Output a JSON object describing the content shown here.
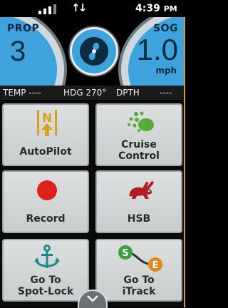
{
  "status_bar": {
    "time": "4:39",
    "ampm": "PM",
    "data_arrows": "↑↓"
  },
  "gauges": {
    "prop": {
      "label": "PROP",
      "value": "3"
    },
    "sog": {
      "label": "SOG",
      "value": "1.0",
      "unit": "mph"
    }
  },
  "info": {
    "temp": "TEMP ----",
    "hdg": "HDG 270°",
    "dpth": "DPTH",
    "dpth_value": "----"
  },
  "tiles": [
    {
      "label_line1": "AutoPilot",
      "label_line2": "",
      "icon": "autopilot-icon"
    },
    {
      "label_line1": "Cruise",
      "label_line2": "Control",
      "icon": "cruise-control-icon"
    },
    {
      "label_line1": "Record",
      "label_line2": "",
      "icon": "record-icon"
    },
    {
      "label_line1": "HSB",
      "label_line2": "",
      "icon": "hsb-rabbit-icon"
    },
    {
      "label_line1": "Go To",
      "label_line2": "Spot-Lock",
      "icon": "anchor-icon"
    },
    {
      "label_line1": "Go To",
      "label_line2": "iTrack",
      "icon": "itrack-icon"
    }
  ],
  "itrack_icon_letters": {
    "start": "S",
    "end": "E"
  },
  "autopilot_letter": "N",
  "colors": {
    "gauge_blue": "#3ea2dc",
    "record_red": "#e0201b",
    "cruise_green": "#5aaa3a",
    "hsb_red": "#b01d1d",
    "anchor_teal": "#1c8a8c",
    "autopilot_gold": "#d9a21e",
    "itrack_green": "#3aa23c",
    "itrack_orange": "#e08a1c"
  }
}
